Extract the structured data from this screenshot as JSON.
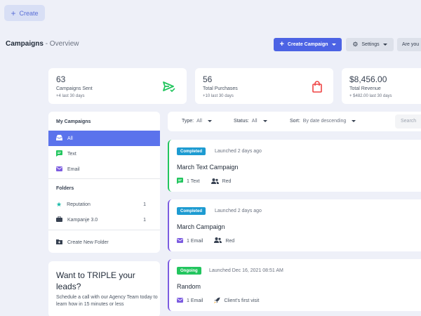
{
  "top_button": {
    "label": "Create"
  },
  "header": {
    "title": "Campaigns",
    "subtitle": "- Overview",
    "create_campaign_label": "Create Campaign",
    "settings_label": "Settings",
    "truncated_button_label": "Are you"
  },
  "stats": [
    {
      "value": "63",
      "label": "Campaigns Sent",
      "delta": "+4 last 30 days",
      "icon": "send-check-icon",
      "color": "#22c55e"
    },
    {
      "value": "56",
      "label": "Total Purchases",
      "delta": "+10 last 30 days",
      "icon": "shopping-bag-icon",
      "color": "#ef4444"
    },
    {
      "value": "$8,456.00",
      "label": "Total Revenue",
      "delta": "+ $482.00 last 30 days",
      "icon": "",
      "color": ""
    }
  ],
  "sidebar": {
    "my_campaigns_heading": "My Campaigns",
    "items": [
      {
        "label": "All",
        "icon": "inbox-icon"
      },
      {
        "label": "Text",
        "icon": "chat-icon"
      },
      {
        "label": "Email",
        "icon": "mail-icon"
      }
    ],
    "folders_heading": "Folders",
    "folders": [
      {
        "label": "Reputation",
        "count": "1",
        "icon": "star-icon"
      },
      {
        "label": "Kampanje 3.0",
        "count": "1",
        "icon": "briefcase-icon"
      }
    ],
    "new_folder_label": "Create New Folder"
  },
  "promo": {
    "headline": "Want to TRIPLE your leads?",
    "body": "Schedule a call with our Agency Team today to learn how in 15 minutes or less"
  },
  "filters": {
    "type_label": "Type:",
    "type_value": "All",
    "status_label": "Status:",
    "status_value": "All",
    "sort_label": "Sort:",
    "sort_value": "By date descending",
    "search_placeholder": "Search"
  },
  "campaigns": [
    {
      "status": "Completed",
      "status_color": "#1d9bd1",
      "border_color": "#22c55e",
      "launched": "Launched 2 days ago",
      "name": "March Text Campaign",
      "channel": "1 Text",
      "channel_icon": "chat-icon",
      "audience": "Red"
    },
    {
      "status": "Completed",
      "status_color": "#1d9bd1",
      "border_color": "#7c5ce0",
      "launched": "Launched 2 days ago",
      "name": "March Campaign",
      "channel": "1 Email",
      "channel_icon": "mail-icon",
      "audience": "Red"
    },
    {
      "status": "Ongoing",
      "status_color": "#22c55e",
      "border_color": "#7c5ce0",
      "launched": "Launched Dec 16, 2021 08:51 AM",
      "name": "Random",
      "channel": "1 Email",
      "channel_icon": "mail-icon",
      "audience": "Client's first visit"
    }
  ]
}
